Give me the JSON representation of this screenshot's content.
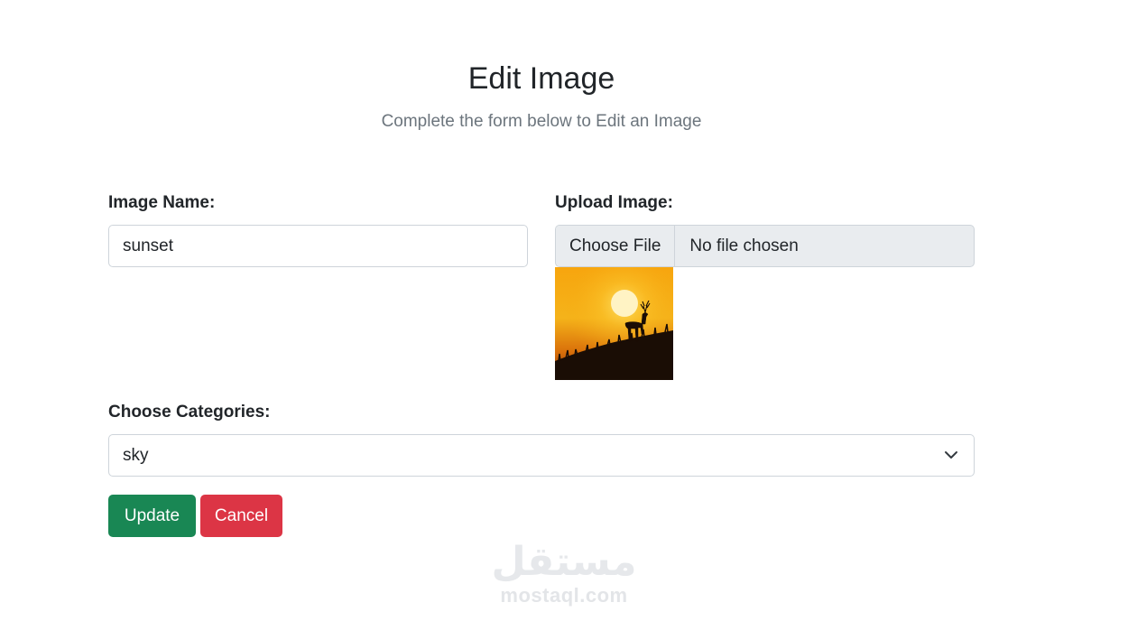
{
  "header": {
    "title": "Edit Image",
    "subtitle": "Complete the form below to Edit an Image"
  },
  "form": {
    "image_name": {
      "label": "Image Name:",
      "value": "sunset"
    },
    "upload": {
      "label": "Upload Image:",
      "button": "Choose File",
      "status": "No file chosen",
      "preview_icon": "deer-sunset-image"
    },
    "categories": {
      "label": "Choose Categories:",
      "selected": "sky"
    },
    "buttons": {
      "update": "Update",
      "cancel": "Cancel"
    }
  },
  "watermark": {
    "arabic": "مستقل",
    "latin": "mostaql.com"
  },
  "colors": {
    "update": "#198754",
    "cancel": "#dc3545",
    "input_border": "#ced4da",
    "file_bg": "#e9ecef",
    "subtitle": "#6c757d"
  }
}
